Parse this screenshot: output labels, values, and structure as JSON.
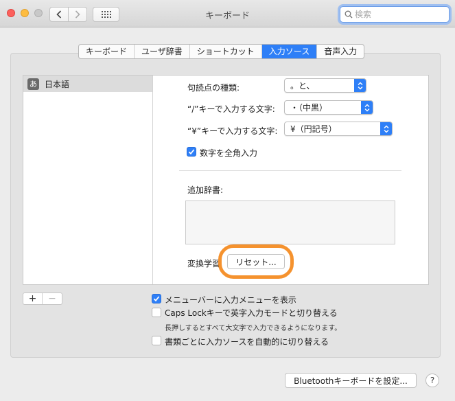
{
  "window": {
    "title": "キーボード"
  },
  "search": {
    "placeholder": "検索"
  },
  "tabs": [
    {
      "label": "キーボード",
      "active": false
    },
    {
      "label": "ユーザ辞書",
      "active": false
    },
    {
      "label": "ショートカット",
      "active": false
    },
    {
      "label": "入力ソース",
      "active": true
    },
    {
      "label": "音声入力",
      "active": false
    }
  ],
  "sources": {
    "items": [
      {
        "icon_char": "あ",
        "label": "日本語",
        "selected": true
      }
    ]
  },
  "settings": {
    "punctuation": {
      "label": "句読点の種類:",
      "value": "。と、"
    },
    "slash": {
      "label": "“/”キーで入力する文字:",
      "value": "・（中黒）"
    },
    "yen": {
      "label": "“¥”キーで入力する文字:",
      "value": "¥（円記号）"
    },
    "fullwidth_numbers": {
      "label": "数字を全角入力",
      "checked": true
    },
    "extra_dict": {
      "label": "追加辞書:"
    },
    "learning": {
      "label": "変換学習",
      "reset_label": "リセット..."
    }
  },
  "list_controls": {
    "add": "+",
    "remove": "−"
  },
  "options": {
    "show_menu": {
      "label": "メニューバーに入力メニューを表示",
      "checked": true
    },
    "caps_lock": {
      "label": "Caps Lockキーで英字入力モードと切り替える",
      "checked": false,
      "hint": "長押しするとすべて大文字で入力できるようになります。"
    },
    "auto_switch": {
      "label": "書類ごとに入力ソースを自動的に切り替える",
      "checked": false
    }
  },
  "footer": {
    "bluetooth_label": "Bluetoothキーボードを設定...",
    "help_label": "?"
  },
  "colors": {
    "accent": "#2e7ff7",
    "highlight": "#f5922e"
  }
}
